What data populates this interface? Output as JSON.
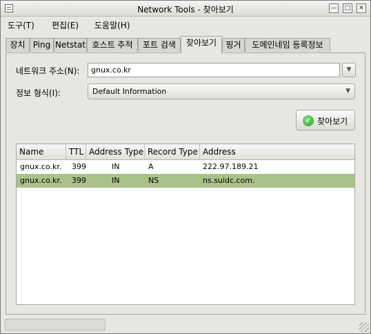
{
  "window": {
    "title": "Network Tools - 찾아보기",
    "minimize_icon": "minimize-icon",
    "maximize_icon": "maximize-icon",
    "close_icon": "close-icon"
  },
  "menubar": [
    {
      "label": "도구(T)"
    },
    {
      "label": "편집(E)"
    },
    {
      "label": "도움말(H)"
    }
  ],
  "tabs": [
    {
      "label": "장치"
    },
    {
      "label": "Ping"
    },
    {
      "label": "Netstat"
    },
    {
      "label": "호스트 추적"
    },
    {
      "label": "포트 검색"
    },
    {
      "label": "찾아보기",
      "active": true
    },
    {
      "label": "핑거"
    },
    {
      "label": "도메인네임 등록정보"
    }
  ],
  "form": {
    "address_label": "네트워크 주소(N):",
    "address_value": "gnux.co.kr",
    "format_label": "정보 형식(I):",
    "format_value": "Default Information",
    "lookup_button": "찾아보기"
  },
  "table": {
    "columns": [
      "Name",
      "TTL",
      "Address Type",
      "Record Type",
      "Address"
    ],
    "rows": [
      {
        "name": "gnux.co.kr.",
        "ttl": "399",
        "address_type": "IN",
        "record_type": "A",
        "address": "222.97.189.21",
        "selected": false
      },
      {
        "name": "gnux.co.kr.",
        "ttl": "399",
        "address_type": "IN",
        "record_type": "NS",
        "address": "ns.suidc.com.",
        "selected": true
      }
    ]
  },
  "colors": {
    "selection": "#a9c28a",
    "window_bg": "#e7e6e3"
  }
}
